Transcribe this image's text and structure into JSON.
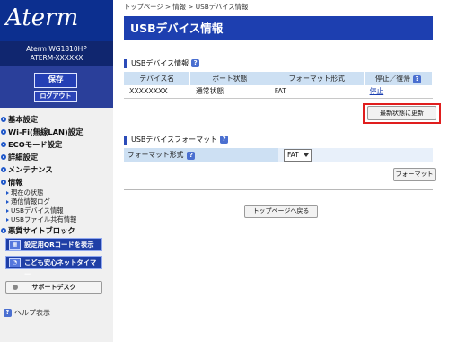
{
  "sidebar": {
    "logo": "Aterm",
    "model": "Aterm WG1810HP",
    "device_id": "ATERM-XXXXXX",
    "save_label": "保存",
    "logout_label": "ログアウト",
    "menu": [
      {
        "label": "基本設定"
      },
      {
        "label": "Wi-Fi(無線LAN)設定"
      },
      {
        "label": "ECOモード設定"
      },
      {
        "label": "詳細設定"
      },
      {
        "label": "メンテナンス"
      },
      {
        "label": "情報"
      }
    ],
    "submenu": [
      {
        "label": "現在の状態"
      },
      {
        "label": "通信情報ログ"
      },
      {
        "label": "USBデバイス情報"
      },
      {
        "label": "USBファイル共有情報"
      }
    ],
    "menu_extra": {
      "label": "悪質サイトブロック"
    },
    "qr_button": "設定用QRコードを表示",
    "kids_button": "こども安心ネットタイマー",
    "support_button": "サポートデスク",
    "help_label": "ヘルプ表示"
  },
  "main": {
    "breadcrumb": "トップページ > 情報 > USBデバイス情報",
    "title": "USBデバイス情報",
    "device_section": {
      "title": "USBデバイス情報",
      "headers": [
        "デバイス名",
        "ポート状態",
        "フォーマット形式",
        "停止／復帰"
      ],
      "rows": [
        {
          "device": "XXXXXXXX",
          "port": "通常状態",
          "format": "FAT",
          "action": "停止"
        }
      ],
      "refresh_button": "最新状態に更新"
    },
    "format_section": {
      "title": "USBデバイスフォーマット",
      "label": "フォーマット形式",
      "selected": "FAT",
      "button": "フォーマット"
    },
    "top_button": "トップページへ戻る"
  },
  "colors": {
    "brand_blue": "#1d3fb0",
    "header_cell": "#cde0f3",
    "highlight_red": "#e01e1e"
  }
}
